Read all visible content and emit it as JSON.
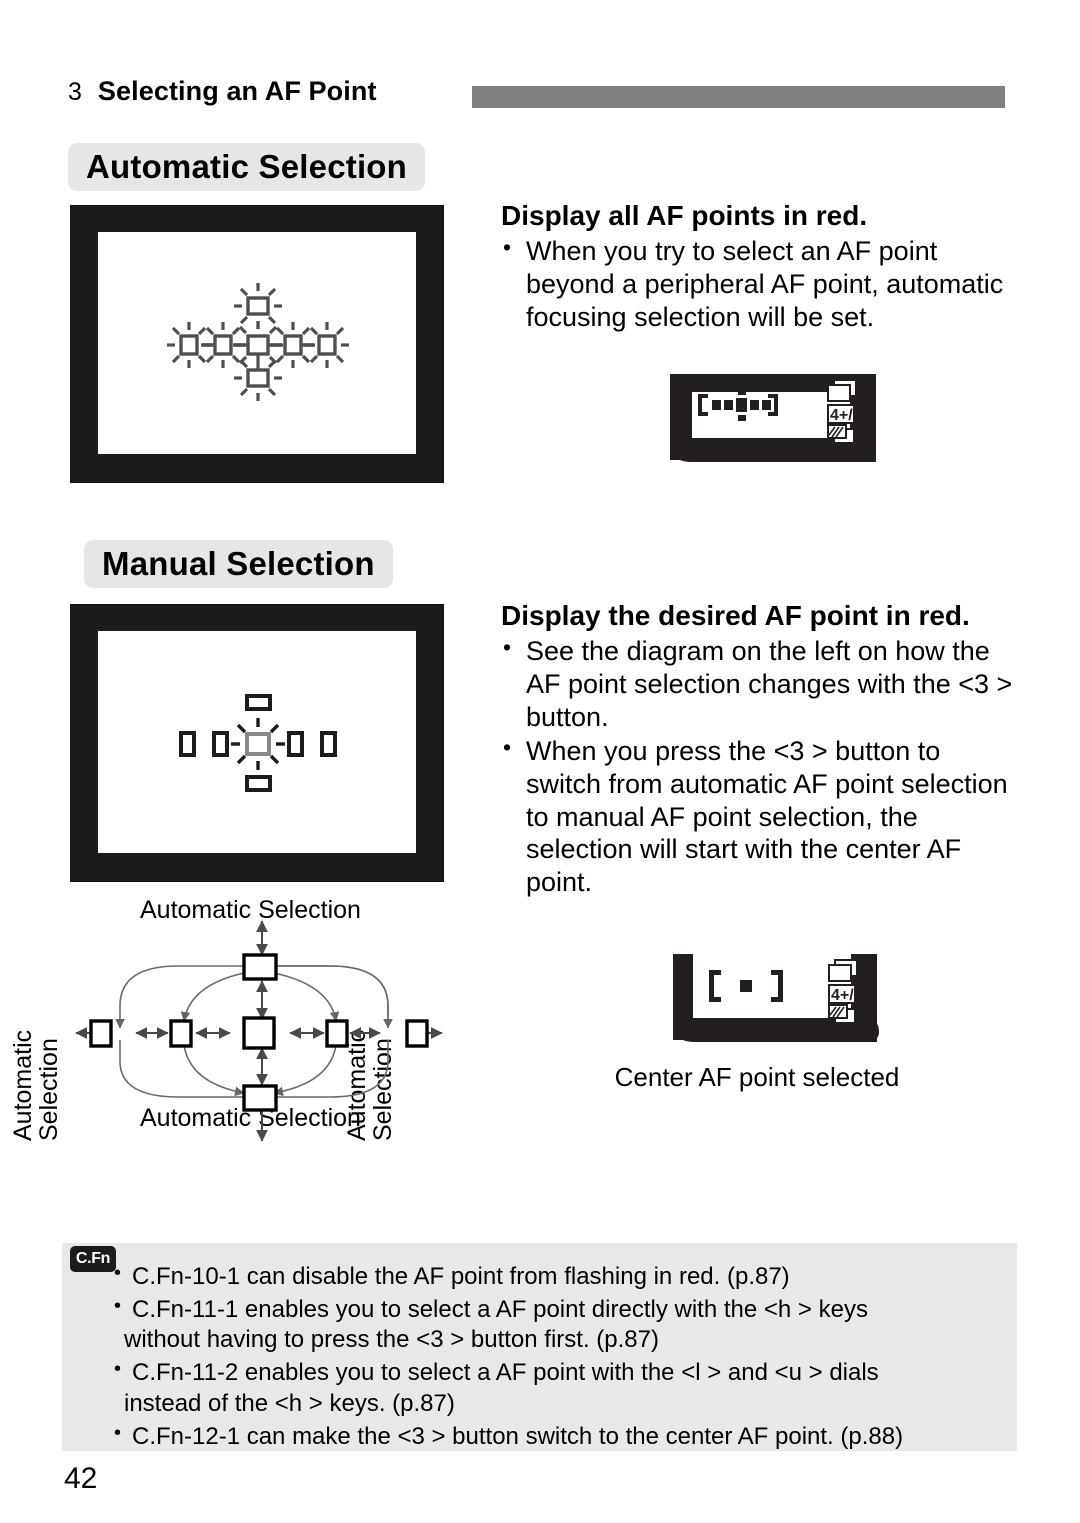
{
  "runhead": {
    "number": "3",
    "title": "Selecting an AF Point"
  },
  "sections": {
    "automatic": {
      "heading": "Automatic Selection",
      "subhead": "Display all AF points in red.",
      "bullets": [
        "When you try to select an AF point beyond a peripheral AF point, automatic focusing selection will be set."
      ]
    },
    "manual": {
      "heading": "Manual Selection",
      "subhead": "Display the desired AF point in red.",
      "bullets": [
        "See the diagram on the left on how the AF point selection changes with the <3 > button.",
        "When you press the <3 > button to switch from automatic AF point selection to manual AF point selection, the selection will start with the center AF point."
      ],
      "lcd_caption": "Center AF point selected"
    }
  },
  "flow_diagram": {
    "label_top": "Automatic Selection",
    "label_bottom": "Automatic Selection",
    "label_left_line1": "Automatic",
    "label_left_line2": "Selection",
    "label_right_line1": "Automatic",
    "label_right_line2": "Selection"
  },
  "cfn": {
    "badge": "C.Fn",
    "notes": [
      "C.Fn-10-1 can disable the AF point from flashing in red. (p.87)",
      "C.Fn-11-1 enables you to select a AF point directly with the <h  > keys without having to press the <3  > button first. (p.87)",
      "C.Fn-11-2 enables you to select a AF point with the <l     > and <u  > dials instead of the <h  > keys. (p.87)",
      "C.Fn-12-1 can make the <3  > button switch to the center AF point. (p.88)"
    ],
    "note_lines": [
      [
        "C.Fn-10-1 can disable the AF point from flashing in red. (p.87)"
      ],
      [
        "C.Fn-11-1 enables you to select a AF point directly with the <h  > keys",
        "without having to press the <3  > button first. (p.87)"
      ],
      [
        "C.Fn-11-2 enables you to select a AF point with the <l     > and <u  > dials",
        "instead of the <h  > keys. (p.87)"
      ],
      [
        "C.Fn-12-1 can make the <3  > button switch to the center AF point. (p.88)"
      ]
    ]
  },
  "folio": "42",
  "colors": {
    "rule_bar": "#808080",
    "heading_chip": "#e6e6e6",
    "note_box": "#e8e8e8",
    "viewfinder_frame": "#1c1c1c",
    "badge": "#1c1c1c"
  }
}
